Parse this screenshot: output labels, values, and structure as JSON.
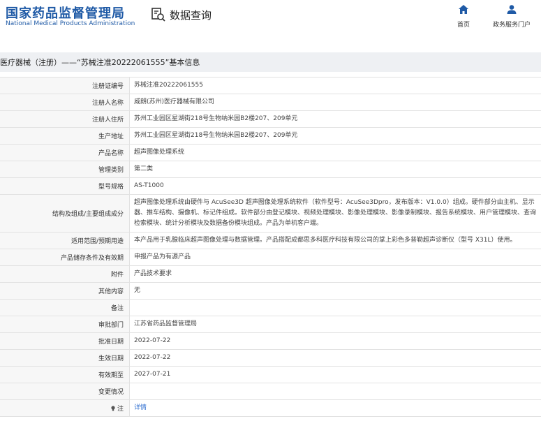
{
  "header": {
    "logo_cn": "国家药品监督管理局",
    "logo_en": "National Medical Products Administration",
    "query_title": "数据查询",
    "query_icon": "search-document-icon",
    "nav": [
      {
        "label": "首页",
        "icon": "home-icon"
      },
      {
        "label": "政务服务门户",
        "icon": "user-icon"
      }
    ]
  },
  "breadcrumb": "医疗器械（注册）——“苏械注准20222061555”基本信息",
  "rows": [
    {
      "label": "注册证编号",
      "value": "苏械注准20222061555"
    },
    {
      "label": "注册人名称",
      "value": "威朗(苏州)医疗器械有限公司"
    },
    {
      "label": "注册人住所",
      "value": "苏州工业园区星湖街218号生物纳米园B2楼207、209单元"
    },
    {
      "label": "生产地址",
      "value": "苏州工业园区星湖街218号生物纳米园B2楼207、209单元"
    },
    {
      "label": "产品名称",
      "value": "超声图像处理系统"
    },
    {
      "label": "管理类别",
      "value": "第二类"
    },
    {
      "label": "型号规格",
      "value": "AS-T1000"
    },
    {
      "label": "结构及组成/主要组成成分",
      "value": "超声图像处理系统由硬件与 AcuSee3D 超声图像处理系统软件（软件型号：AcuSee3Dpro，发布版本：V1.0.0）组成。硬件部分由主机、显示器、推车结构、摄像机、标记件组成。软件部分由登记模块、视频处理模块、影像处理模块、影像录制模块、报告系统模块、用户管理模块、查询检索模块、统计分析模块及数据备份模块组成。产品为单机客户端。"
    },
    {
      "label": "适用范围/预期用途",
      "value": "本产品用于乳腺临床超声图像处理与数据管理。产品搭配成都思多科医疗科技有限公司的掌上彩色多普勒超声诊断仪（型号 X31L）使用。"
    },
    {
      "label": "产品储存条件及有效期",
      "value": "申报产品为有源产品"
    },
    {
      "label": "附件",
      "value": "产品技术要求"
    },
    {
      "label": "其他内容",
      "value": "无"
    },
    {
      "label": "备注",
      "value": ""
    },
    {
      "label": "审批部门",
      "value": "江苏省药品监督管理局"
    },
    {
      "label": "批准日期",
      "value": "2022-07-22"
    },
    {
      "label": "生效日期",
      "value": "2022-07-22"
    },
    {
      "label": "有效期至",
      "value": "2027-07-21"
    },
    {
      "label": "变更情况",
      "value": ""
    }
  ],
  "note": {
    "label": "注",
    "icon": "bulb-icon",
    "link": "详情"
  },
  "colors": {
    "brand": "#1f5aa6",
    "link": "#2f6fd0",
    "label_bg": "#f7f7f7",
    "border": "#e2e2e2",
    "breadcrumb_bg": "#eef0f3"
  }
}
